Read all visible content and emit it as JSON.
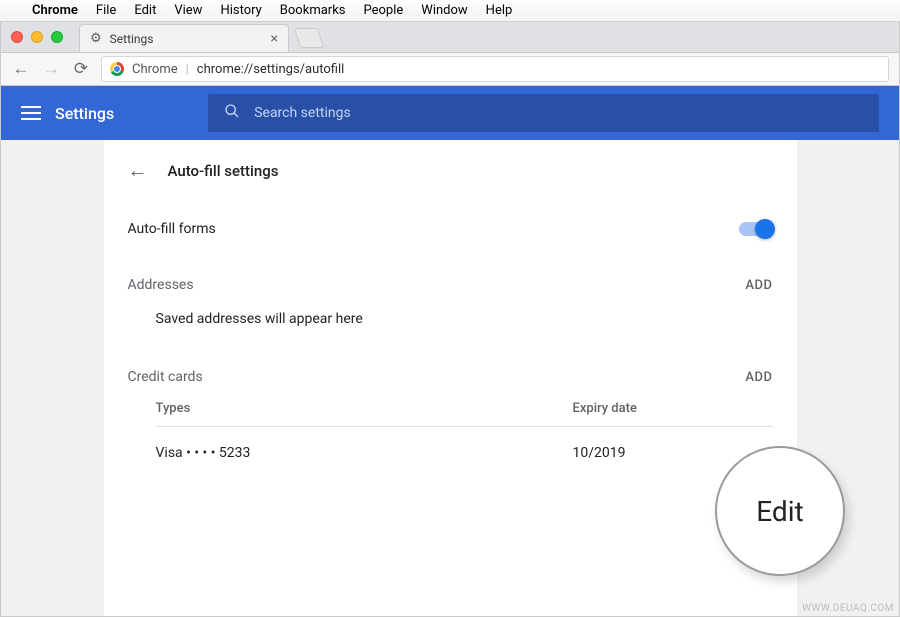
{
  "mac_menu": {
    "app": "Chrome",
    "items": [
      "File",
      "Edit",
      "View",
      "History",
      "Bookmarks",
      "People",
      "Window",
      "Help"
    ]
  },
  "tab": {
    "title": "Settings"
  },
  "omnibox": {
    "product": "Chrome",
    "url": "chrome://settings/autofill"
  },
  "header": {
    "title": "Settings",
    "search_placeholder": "Search settings"
  },
  "page": {
    "title": "Auto-fill settings",
    "autofill_label": "Auto-fill forms",
    "addresses": {
      "label": "Addresses",
      "add": "ADD",
      "empty": "Saved addresses will appear here"
    },
    "cards": {
      "label": "Credit cards",
      "add": "ADD",
      "col_types": "Types",
      "col_expiry": "Expiry date",
      "rows": [
        {
          "type": "Visa • • • • 5233",
          "expiry": "10/2019"
        }
      ]
    }
  },
  "callout": "Edit",
  "watermark": "WWW.DEUAQ.COM"
}
